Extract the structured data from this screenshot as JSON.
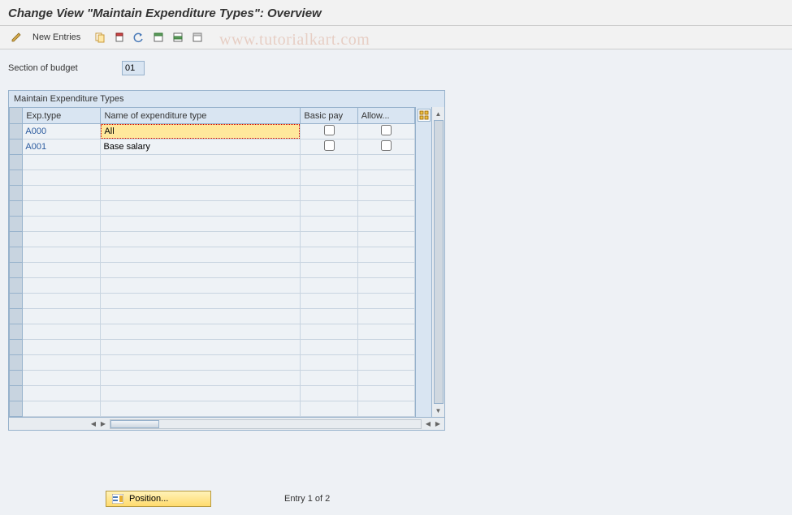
{
  "title": "Change View \"Maintain Expenditure Types\": Overview",
  "toolbar": {
    "new_entries": "New Entries"
  },
  "field": {
    "section_label": "Section of budget",
    "section_value": "01"
  },
  "table": {
    "title": "Maintain Expenditure Types",
    "headers": {
      "exptype": "Exp.type",
      "name": "Name of expenditure type",
      "basicpay": "Basic pay",
      "allow": "Allow..."
    },
    "rows": [
      {
        "exptype": "A000",
        "name": "All",
        "basicpay": false,
        "allow": false,
        "active": true
      },
      {
        "exptype": "A001",
        "name": "Base salary",
        "basicpay": false,
        "allow": false,
        "active": false
      }
    ],
    "empty_rows": 17
  },
  "bottom": {
    "position_label": "Position...",
    "entry_status": "Entry 1 of 2"
  },
  "watermark": "www.tutorialkart.com"
}
